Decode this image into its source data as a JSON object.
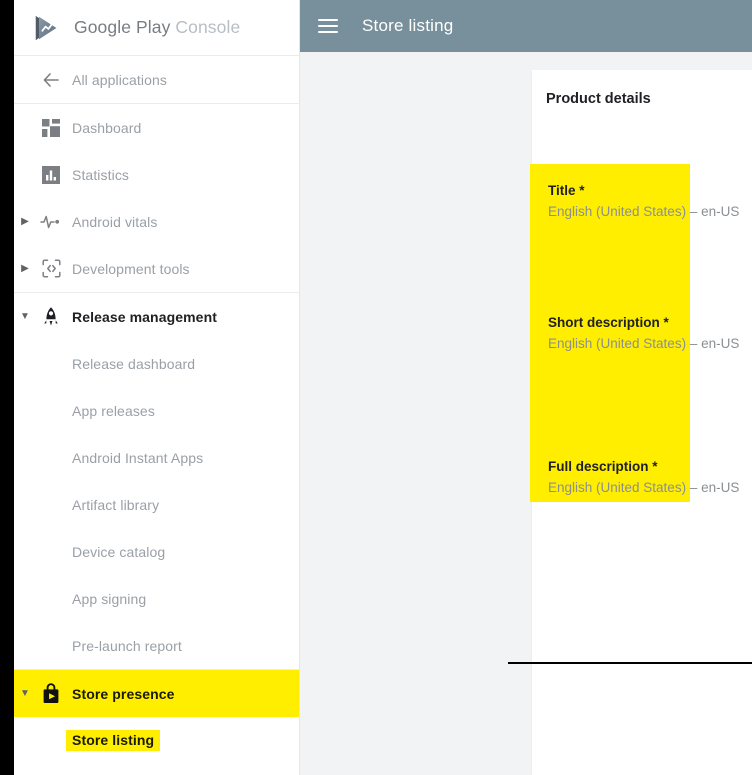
{
  "brand": {
    "logo_icon": "google-play-console-logo",
    "name_strong": "Google Play",
    "name_light": "Console"
  },
  "topbar": {
    "menu_icon": "hamburger-menu-icon",
    "title": "Store listing"
  },
  "sidebar": {
    "items": [
      {
        "id": "all-applications",
        "label": "All applications",
        "icon": "back-arrow-icon",
        "caret": "",
        "level": "top",
        "highlight": "none",
        "divider_after": true
      },
      {
        "id": "dashboard",
        "label": "Dashboard",
        "icon": "dashboard-grid-icon",
        "caret": "",
        "level": "top",
        "highlight": "none",
        "divider_after": false
      },
      {
        "id": "statistics",
        "label": "Statistics",
        "icon": "statistics-bar-chart-icon",
        "caret": "",
        "level": "top",
        "highlight": "none",
        "divider_after": false
      },
      {
        "id": "android-vitals",
        "label": "Android vitals",
        "icon": "vitals-pulse-icon",
        "caret": "collapsed",
        "level": "top",
        "highlight": "none",
        "divider_after": false
      },
      {
        "id": "development-tools",
        "label": "Development tools",
        "icon": "code-brackets-icon",
        "caret": "collapsed",
        "level": "top",
        "highlight": "none",
        "divider_after": true
      },
      {
        "id": "release-management",
        "label": "Release management",
        "icon": "rocket-icon",
        "caret": "expanded",
        "level": "top",
        "highlight": "none",
        "active": true,
        "divider_after": false
      },
      {
        "id": "release-dashboard",
        "label": "Release dashboard",
        "icon": "",
        "caret": "",
        "level": "sub",
        "highlight": "none",
        "divider_after": false
      },
      {
        "id": "app-releases",
        "label": "App releases",
        "icon": "",
        "caret": "",
        "level": "sub",
        "highlight": "none",
        "divider_after": false
      },
      {
        "id": "android-instant-apps",
        "label": "Android Instant Apps",
        "icon": "",
        "caret": "",
        "level": "sub",
        "highlight": "none",
        "divider_after": false
      },
      {
        "id": "artifact-library",
        "label": "Artifact library",
        "icon": "",
        "caret": "",
        "level": "sub",
        "highlight": "none",
        "divider_after": false
      },
      {
        "id": "device-catalog",
        "label": "Device catalog",
        "icon": "",
        "caret": "",
        "level": "sub",
        "highlight": "none",
        "divider_after": false
      },
      {
        "id": "app-signing",
        "label": "App signing",
        "icon": "",
        "caret": "",
        "level": "sub",
        "highlight": "none",
        "divider_after": false
      },
      {
        "id": "pre-launch-report",
        "label": "Pre-launch report",
        "icon": "",
        "caret": "",
        "level": "sub",
        "highlight": "none",
        "divider_after": true
      },
      {
        "id": "store-presence",
        "label": "Store presence",
        "icon": "store-bag-play-icon",
        "caret": "expanded",
        "level": "top",
        "highlight": "row",
        "divider_after": false
      },
      {
        "id": "store-listing",
        "label": "Store listing",
        "icon": "",
        "caret": "",
        "level": "sub",
        "highlight": "text",
        "divider_after": false
      }
    ]
  },
  "card": {
    "title": "Product details",
    "fields": [
      {
        "id": "title",
        "label": "Title",
        "required_marker": "*",
        "language": "English (United States)",
        "separator": "–",
        "locale_code": "en-US"
      },
      {
        "id": "short-description",
        "label": "Short description",
        "required_marker": "*",
        "language": "English (United States)",
        "separator": "–",
        "locale_code": "en-US"
      },
      {
        "id": "full-description",
        "label": "Full description",
        "required_marker": "*",
        "language": "English (United States)",
        "separator": "–",
        "locale_code": "en-US"
      }
    ]
  },
  "colors": {
    "highlight_yellow": "#ffee00",
    "topbar_slate": "#78909c",
    "content_background": "#f1f3f4",
    "muted_text": "#9aa0a6",
    "strong_text": "#202124"
  }
}
